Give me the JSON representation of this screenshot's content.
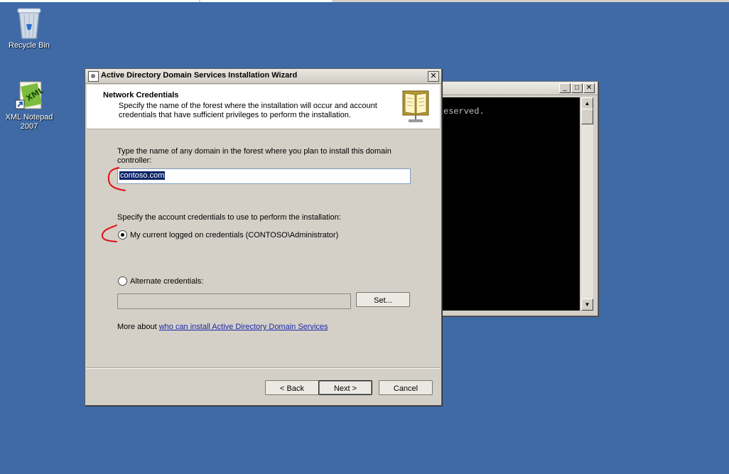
{
  "desktop": {
    "icons": [
      {
        "label": "Recycle Bin",
        "icon": "recycle-bin-icon"
      },
      {
        "label": "XML Notepad\n2007",
        "icon": "xml-notepad-icon"
      }
    ]
  },
  "console": {
    "output": "eserved."
  },
  "wizard": {
    "title": "Active Directory Domain Services Installation Wizard",
    "close_label": "✕",
    "header": {
      "title": "Network Credentials",
      "subtitle": "Specify the name of the forest where the installation will occur and account credentials that have sufficient privileges to perform the installation."
    },
    "domain_prompt": "Type the name of any domain in the forest where you plan to install this domain controller:",
    "domain_value": "contoso.com",
    "credentials_prompt": "Specify the account credentials to use to perform the installation:",
    "radio_current": "My current logged on credentials (CONTOSO\\Administrator)",
    "radio_alternate": "Alternate credentials:",
    "alternate_value": "",
    "set_button": "Set...",
    "more_about_prefix": "More about ",
    "more_about_link": "who can install Active Directory Domain Services",
    "buttons": {
      "back": "< Back",
      "next": "Next >",
      "cancel": "Cancel"
    },
    "selected_option": "current"
  },
  "colors": {
    "desktop": "#3f6aa6",
    "annotation": "#e01010",
    "selection": "#0a246a",
    "link": "#1a2aa8"
  }
}
